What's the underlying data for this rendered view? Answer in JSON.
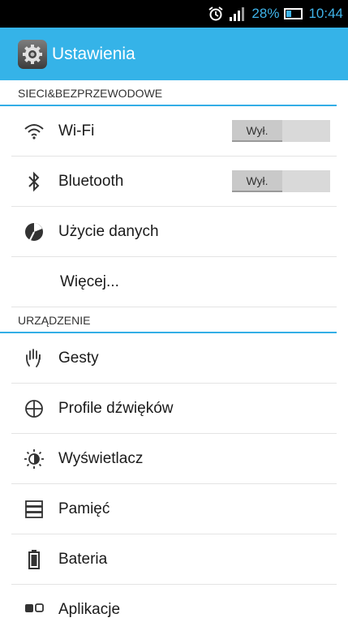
{
  "statusbar": {
    "battery_percent": "28%",
    "time": "10:44"
  },
  "actionbar": {
    "title": "Ustawienia"
  },
  "sections": {
    "network": {
      "header": "SIECI&BEZPRZEWODOWE",
      "items": [
        {
          "label": "Wi-Fi",
          "icon": "wifi-icon",
          "toggle": "Wył."
        },
        {
          "label": "Bluetooth",
          "icon": "bluetooth-icon",
          "toggle": "Wył."
        },
        {
          "label": "Użycie danych",
          "icon": "data-usage-icon"
        },
        {
          "label": "Więcej..."
        }
      ]
    },
    "device": {
      "header": "URZĄDZENIE",
      "items": [
        {
          "label": "Gesty",
          "icon": "gesture-hand-icon"
        },
        {
          "label": "Profile dźwięków",
          "icon": "sound-profile-icon"
        },
        {
          "label": "Wyświetlacz",
          "icon": "brightness-icon"
        },
        {
          "label": "Pamięć",
          "icon": "storage-icon"
        },
        {
          "label": "Bateria",
          "icon": "battery-icon"
        },
        {
          "label": "Aplikacje",
          "icon": "apps-icon"
        }
      ]
    }
  },
  "colors": {
    "accent": "#35b3e8",
    "status_text": "#3fb4ea"
  }
}
